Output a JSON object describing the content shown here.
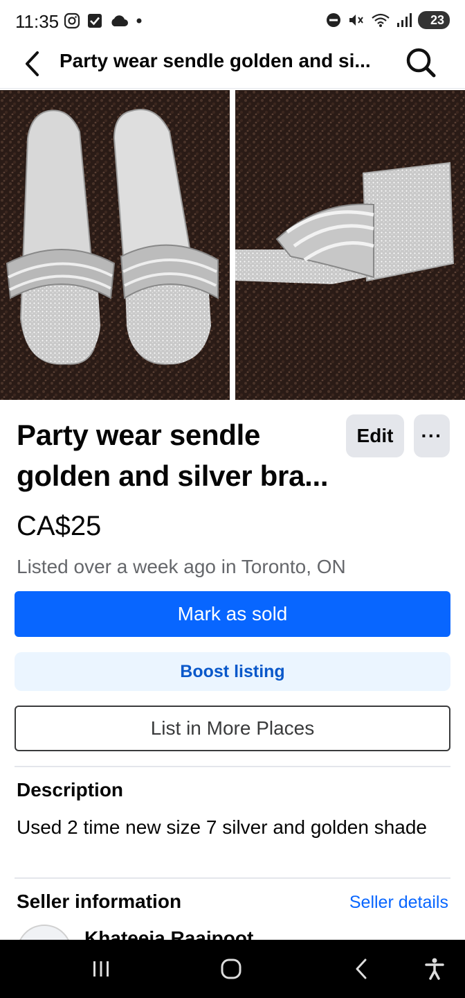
{
  "status_bar": {
    "time": "11:35",
    "battery": "23"
  },
  "header": {
    "title": "Party wear sendle golden and si...",
    "back_icon": "chevron-left-icon",
    "search_icon": "search-icon"
  },
  "listing": {
    "title": "Party wear sendle golden and silver bra...",
    "price": "CA$25",
    "listed": "Listed over a week ago in Toronto, ON",
    "edit_label": "Edit",
    "more_label": "···"
  },
  "actions": {
    "mark_sold": "Mark as sold",
    "boost": "Boost listing",
    "list_more": "List in More Places"
  },
  "description": {
    "heading": "Description",
    "text": "Used 2 time  new size 7 silver and golden shade"
  },
  "seller": {
    "heading": "Seller information",
    "details_link": "Seller details",
    "name": "Khateeja Raajpoot"
  },
  "colors": {
    "primary": "#0866ff",
    "boost_bg": "#ebf5ff",
    "boost_text": "#0a58ca",
    "secondary_button": "#e4e6eb",
    "muted_text": "#65676b"
  },
  "nav": {
    "recents_icon": "recents-icon",
    "home_icon": "home-icon",
    "back_icon": "back-icon",
    "accessibility_icon": "accessibility-icon"
  }
}
